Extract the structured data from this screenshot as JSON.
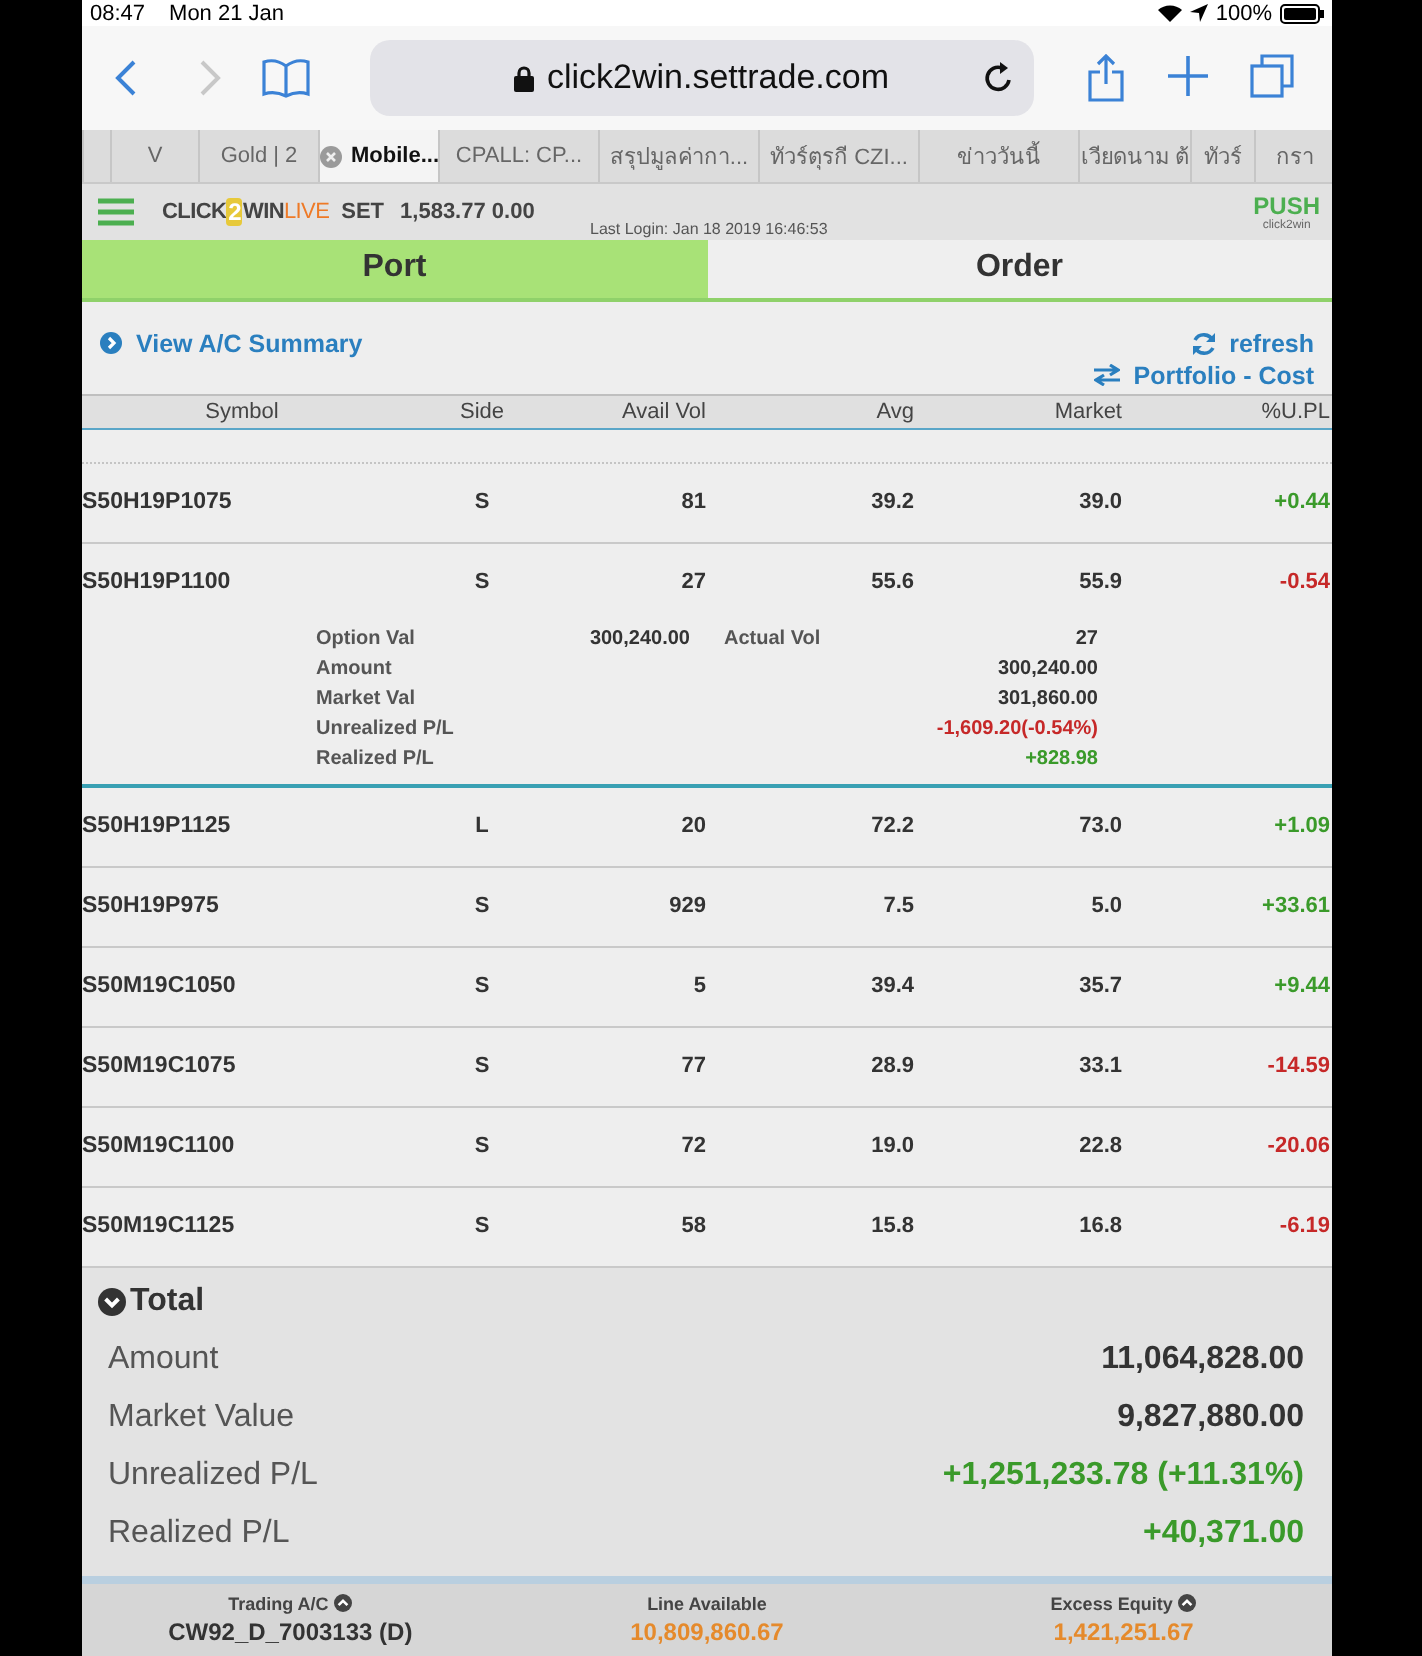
{
  "status_bar": {
    "time": "08:47",
    "date": "Mon 21 Jan",
    "battery": "100%"
  },
  "browser": {
    "url": "click2win.settrade.com"
  },
  "browser_tabs": [
    {
      "label": "V",
      "selected": false
    },
    {
      "label": "Gold | 2",
      "selected": false
    },
    {
      "label": "Mobile...",
      "selected": true
    },
    {
      "label": "CPALL: CP...",
      "selected": false
    },
    {
      "label": "สรุปมูลค่ากา...",
      "selected": false
    },
    {
      "label": "ทัวร์ตุรกี CZI...",
      "selected": false
    },
    {
      "label": "ข่าววันนี้",
      "selected": false
    },
    {
      "label": "เวียดนาม ต้",
      "selected": false
    },
    {
      "label": "ทัวร์",
      "selected": false
    },
    {
      "label": "กรา",
      "selected": false
    }
  ],
  "app_header": {
    "logo_left": "CLICK",
    "logo_digit": "2",
    "logo_mid": "WIN",
    "logo_right": "LIVE",
    "index_name": "SET",
    "index_value": "1,583.77 0.00",
    "last_login": "Last Login: Jan 18 2019 16:46:53",
    "push": "PUSH",
    "push_sub": "click2win"
  },
  "main_tabs": [
    {
      "label": "Port",
      "selected": true
    },
    {
      "label": "Order",
      "selected": false
    }
  ],
  "actions": {
    "summary_link": "View A/C Summary",
    "refresh": "refresh",
    "toggle": "Portfolio - Cost"
  },
  "table": {
    "columns": [
      "Symbol",
      "Side",
      "Avail Vol",
      "Avg",
      "Market",
      "%U.PL"
    ],
    "rows": [
      {
        "cells": [
          "S50H19P1075",
          "S",
          "81",
          "39.2",
          "39.0",
          "+0.44"
        ],
        "color": "#3a9a2a",
        "expanded": false
      },
      {
        "cells": [
          "S50H19P1100",
          "S",
          "27",
          "55.6",
          "55.9",
          "-0.54"
        ],
        "color": "#c62828",
        "expanded": true,
        "details": [
          {
            "label": "Option Val",
            "inline_value": "300,240.00",
            "inline_label": "Actual Vol",
            "value": "27",
            "color": "#333333"
          },
          {
            "label": "Amount",
            "value": "300,240.00",
            "color": "#333333"
          },
          {
            "label": "Market Val",
            "value": "301,860.00",
            "color": "#333333"
          },
          {
            "label": "Unrealized P/L",
            "value": "-1,609.20(-0.54%)",
            "color": "#c62828"
          },
          {
            "label": "Realized P/L",
            "value": "+828.98",
            "color": "#3a9a2a"
          }
        ]
      },
      {
        "cells": [
          "S50H19P1125",
          "L",
          "20",
          "72.2",
          "73.0",
          "+1.09"
        ],
        "color": "#3a9a2a",
        "expanded": false
      },
      {
        "cells": [
          "S50H19P975",
          "S",
          "929",
          "7.5",
          "5.0",
          "+33.61"
        ],
        "color": "#3a9a2a",
        "expanded": false
      },
      {
        "cells": [
          "S50M19C1050",
          "S",
          "5",
          "39.4",
          "35.7",
          "+9.44"
        ],
        "color": "#3a9a2a",
        "expanded": false
      },
      {
        "cells": [
          "S50M19C1075",
          "S",
          "77",
          "28.9",
          "33.1",
          "-14.59"
        ],
        "color": "#c62828",
        "expanded": false
      },
      {
        "cells": [
          "S50M19C1100",
          "S",
          "72",
          "19.0",
          "22.8",
          "-20.06"
        ],
        "color": "#c62828",
        "expanded": false
      },
      {
        "cells": [
          "S50M19C1125",
          "S",
          "58",
          "15.8",
          "16.8",
          "-6.19"
        ],
        "color": "#c62828",
        "expanded": false
      }
    ]
  },
  "total": {
    "title": "Total",
    "expanded": true,
    "items": [
      {
        "label": "Amount",
        "value": "11,064,828.00",
        "color": "#333333"
      },
      {
        "label": "Market Value",
        "value": "9,827,880.00",
        "color": "#333333"
      },
      {
        "label": "Unrealized P/L",
        "value": "+1,251,233.78 (+11.31%)",
        "color": "#3a9a2a"
      },
      {
        "label": "Realized P/L",
        "value": "+40,371.00",
        "color": "#3a9a2a"
      }
    ]
  },
  "footer": [
    {
      "label": "Trading A/C",
      "value": "CW92_D_7003133 (D)",
      "dropdown": true,
      "color": "#333333"
    },
    {
      "label": "Line Available",
      "value": "10,809,860.67",
      "dropdown": false,
      "color": "#e58a2c"
    },
    {
      "label": "Excess Equity",
      "value": "1,421,251.67",
      "dropdown": true,
      "color": "#e58a2c"
    }
  ]
}
